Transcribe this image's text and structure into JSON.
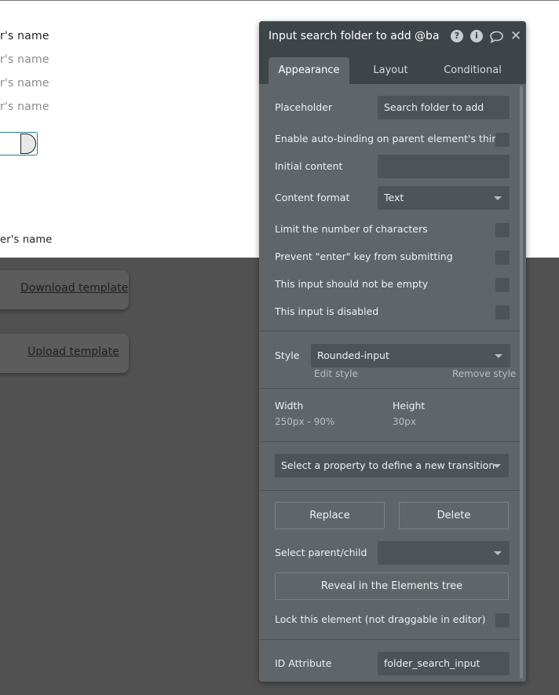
{
  "canvas": {
    "texts": [
      {
        "text": "r's name",
        "tone": "dark"
      },
      {
        "text": "r's name",
        "tone": "light"
      },
      {
        "text": "r's name",
        "tone": "light"
      },
      {
        "text": "r's name",
        "tone": "light"
      },
      {
        "text": "er's name",
        "tone": "dark"
      }
    ],
    "buttons": {
      "download": "Download template",
      "upload": "Upload template"
    }
  },
  "panel": {
    "title": "Input search folder to add @batch",
    "icons": {
      "help": "?",
      "info": "i",
      "close": "✕"
    },
    "tabs": [
      "Appearance",
      "Layout",
      "Conditional"
    ],
    "active_tab": "Appearance",
    "placeholder": {
      "label": "Placeholder",
      "value": "Search folder to add"
    },
    "autobinding": {
      "label": "Enable auto-binding on parent element's thing",
      "checked": false
    },
    "initial_content": {
      "label": "Initial content",
      "value": ""
    },
    "content_format": {
      "label": "Content format",
      "value": "Text"
    },
    "limit_chars": {
      "label": "Limit the number of characters",
      "checked": false
    },
    "prevent_enter": {
      "label": "Prevent \"enter\" key from submitting",
      "checked": false
    },
    "not_empty": {
      "label": "This input should not be empty",
      "checked": false
    },
    "disabled": {
      "label": "This input is disabled",
      "checked": false
    },
    "style": {
      "label": "Style",
      "value": "Rounded-input",
      "edit_link": "Edit style",
      "remove_link": "Remove style"
    },
    "width": {
      "label": "Width",
      "value": "250px - 90%"
    },
    "height": {
      "label": "Height",
      "value": "30px"
    },
    "transition": {
      "placeholder": "Select a property to define a new transition"
    },
    "replace_label": "Replace",
    "delete_label": "Delete",
    "parent_child": {
      "label": "Select parent/child",
      "value": ""
    },
    "reveal_label": "Reveal in the Elements tree",
    "lock": {
      "label": "Lock this element (not draggable in editor)",
      "checked": false
    },
    "id_attribute": {
      "label": "ID Attribute",
      "value": "folder_search_input"
    }
  },
  "colors": {
    "panel_bg": "#5f6569",
    "panel_header": "#3e4549",
    "input_bg": "#4d5357",
    "canvas_dark": "#515151"
  }
}
